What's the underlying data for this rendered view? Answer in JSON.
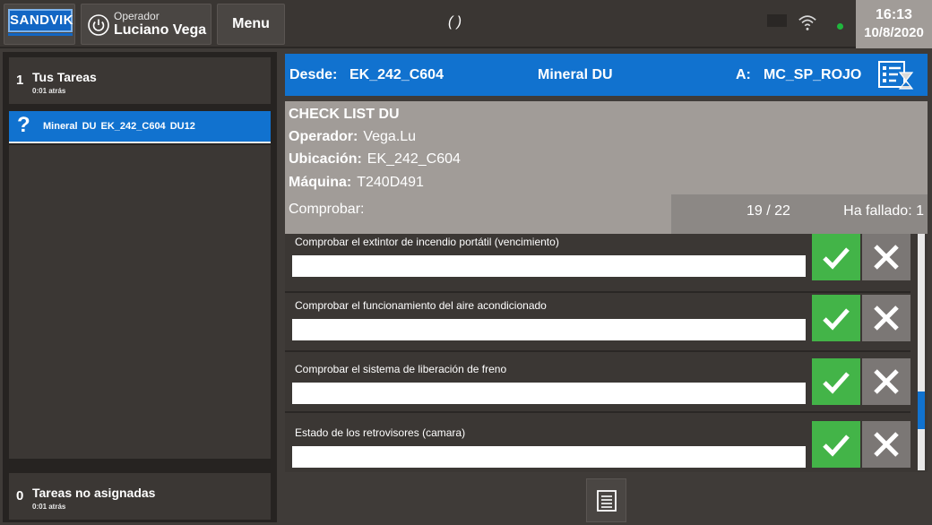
{
  "header": {
    "logo_text": "SANDVIK",
    "operator_label": "Operador",
    "operator_name": "Luciano Vega",
    "menu_label": "Menu",
    "center_status": "( )",
    "clock_time": "16:13",
    "clock_date": "10/8/2020",
    "status_color": "#1fb63d"
  },
  "sidebar": {
    "your_tasks_count": "1",
    "your_tasks_title": "Tus Tareas",
    "your_tasks_time": "0:01 atrás",
    "active_task": {
      "icon": "question-mark-icon",
      "text": "Mineral DU  EK_242_C604  DU12"
    },
    "unassigned_count": "0",
    "unassigned_title": "Tareas no asignadas",
    "unassigned_time": "0:01 atrás"
  },
  "route": {
    "from_label": "Desde:",
    "from_value": "EK_242_C604",
    "material": "Mineral DU",
    "to_label": "A:",
    "to_value": "MC_SP_ROJO"
  },
  "checklist": {
    "title": "CHECK LIST DU",
    "operator_label": "Operador:",
    "operator_value": "Vega.Lu",
    "location_label": "Ubicación:",
    "location_value": "EK_242_C604",
    "machine_label": "Máquina:",
    "machine_value": "T240D491",
    "check_label": "Comprobar:",
    "progress": "19  /  22",
    "failed_text": "Ha fallado: 1",
    "items": [
      {
        "label": "Comprobar el extintor de incendio portátil (vencimiento)",
        "value": ""
      },
      {
        "label": "Comprobar el funcionamiento del aire acondicionado",
        "value": ""
      },
      {
        "label": "Comprobar el sistema de liberación de freno",
        "value": ""
      },
      {
        "label": "Estado de los retrovisores (camara)",
        "value": ""
      }
    ]
  },
  "colors": {
    "accent_blue": "#1172cf",
    "ok_green": "#43b448",
    "reject_gray": "#7b7775"
  }
}
